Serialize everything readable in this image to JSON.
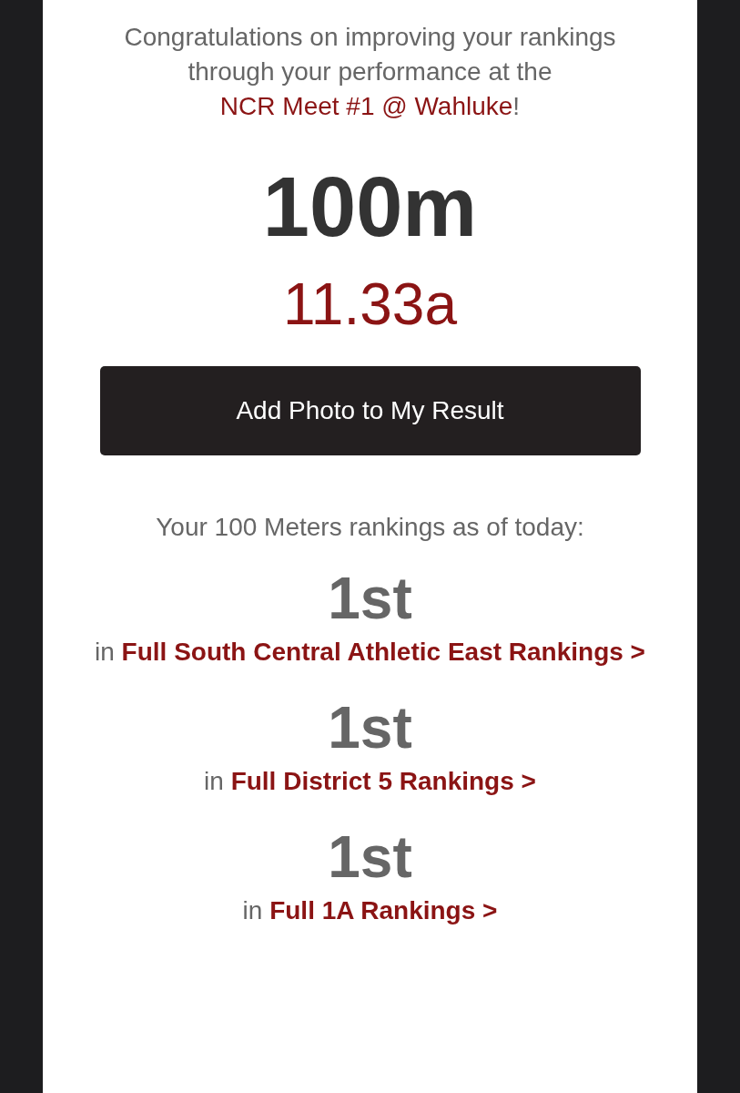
{
  "intro": {
    "text": "Congratulations on improving your rankings through your performance at the",
    "link": "NCR Meet #1 @ Wahluke",
    "suffix": "!"
  },
  "event": "100m",
  "mark": "11.33a",
  "button": "Add Photo to My Result",
  "rankings_heading": "Your 100 Meters rankings as of today:",
  "rankings": [
    {
      "place": "1st",
      "prefix": "in",
      "link": "Full South Central Athletic East Rankings >"
    },
    {
      "place": "1st",
      "prefix": "in",
      "link": "Full District 5 Rankings >"
    },
    {
      "place": "1st",
      "prefix": "in",
      "link": "Full 1A Rankings >"
    }
  ]
}
